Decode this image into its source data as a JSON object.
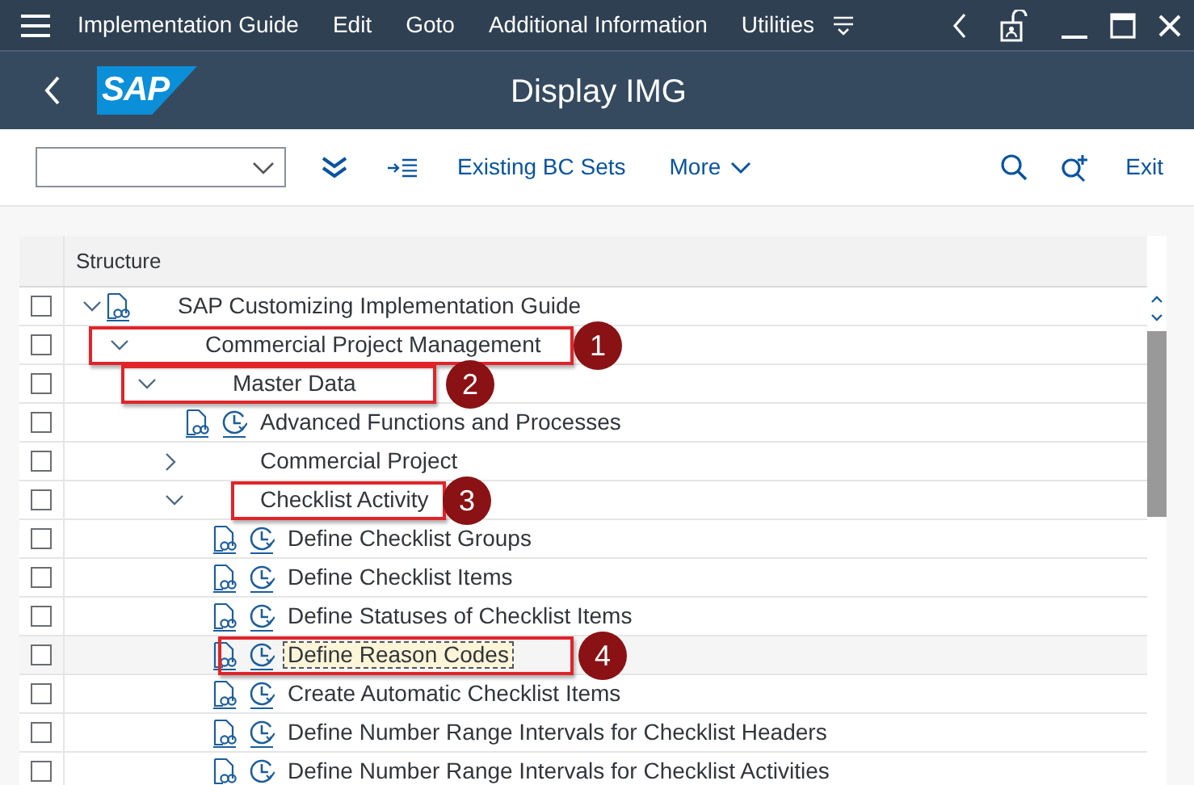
{
  "menu_bar": {
    "items": [
      "Implementation Guide",
      "Edit",
      "Goto",
      "Additional Information",
      "Utilities"
    ]
  },
  "title_bar": {
    "logo": "SAP",
    "title": "Display IMG"
  },
  "toolbar": {
    "buttons": [
      "Existing BC Sets",
      "More"
    ],
    "exit": "Exit"
  },
  "tree": {
    "column": "Structure",
    "rows": [
      {
        "label": "SAP Customizing Implementation Guide",
        "kind": "root",
        "expanded": true,
        "checked": false,
        "selected": false,
        "children": [
          {
            "label": "Commercial Project Management",
            "expanded": true,
            "checked": false,
            "selected": false,
            "callout": "1",
            "children": [
              {
                "label": "Master Data",
                "expanded": true,
                "checked": false,
                "selected": false,
                "callout": "2",
                "children": [
                  {
                    "label": "Advanced Functions and Processes",
                    "kind": "activity",
                    "checked": false,
                    "selected": false
                  },
                  {
                    "label": "Commercial Project",
                    "expanded": false,
                    "checked": false,
                    "selected": false
                  },
                  {
                    "label": "Checklist Activity",
                    "expanded": true,
                    "checked": false,
                    "selected": false,
                    "callout": "3",
                    "children": [
                      {
                        "label": "Define Checklist Groups",
                        "kind": "activity",
                        "checked": false,
                        "selected": false
                      },
                      {
                        "label": "Define Checklist Items",
                        "kind": "activity",
                        "checked": false,
                        "selected": false
                      },
                      {
                        "label": "Define Statuses of Checklist Items",
                        "kind": "activity",
                        "checked": false,
                        "selected": false
                      },
                      {
                        "label": "Define Reason Codes",
                        "kind": "activity",
                        "checked": false,
                        "selected": true,
                        "callout": "4"
                      },
                      {
                        "label": "Create Automatic Checklist Items",
                        "kind": "activity",
                        "checked": false,
                        "selected": false
                      },
                      {
                        "label": "Define Number Range Intervals for Checklist Headers",
                        "kind": "activity",
                        "checked": false,
                        "selected": false
                      },
                      {
                        "label": "Define Number Range Intervals for Checklist Activities",
                        "kind": "activity",
                        "checked": false,
                        "selected": false
                      }
                    ]
                  }
                ]
              }
            ]
          }
        ]
      }
    ]
  }
}
